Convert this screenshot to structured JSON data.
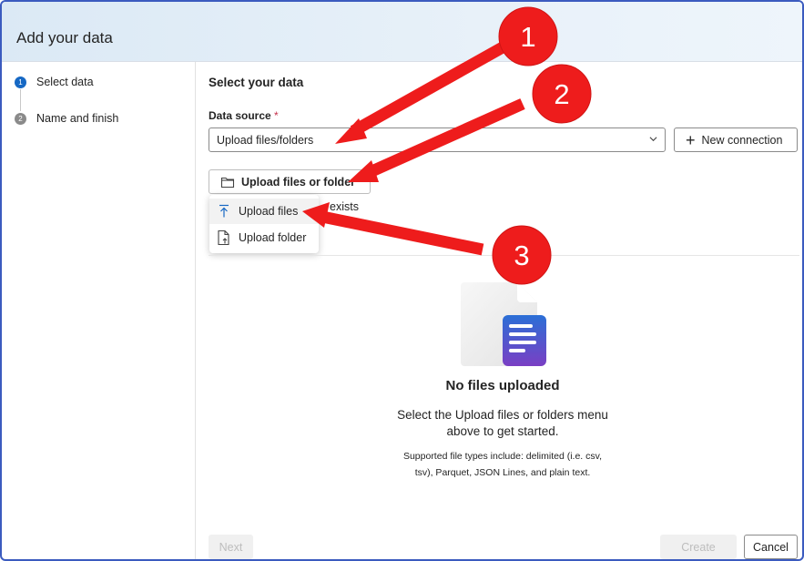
{
  "header": {
    "title": "Add your data"
  },
  "steps": [
    {
      "num": "1",
      "label": "Select data"
    },
    {
      "num": "2",
      "label": "Name and finish"
    }
  ],
  "main": {
    "section_title": "Select your data",
    "data_source_label": "Data source",
    "required_mark": "*",
    "data_source_value": "Upload files/folders",
    "new_connection_label": "New connection",
    "upload_button_label": "Upload files or folder",
    "exists_text": "exists"
  },
  "upload_menu": {
    "items": [
      {
        "label": "Upload files",
        "icon": "upload-arrow-icon"
      },
      {
        "label": "Upload folder",
        "icon": "folder-upload-icon"
      }
    ]
  },
  "empty_state": {
    "title": "No files uploaded",
    "message": "Select the Upload files or folders menu above to get started.",
    "supported": "Supported file types include: delimited (i.e. csv, tsv), Parquet, JSON Lines, and plain text."
  },
  "footer": {
    "next_label": "Next",
    "create_label": "Create",
    "cancel_label": "Cancel"
  },
  "annotations": {
    "color": "#ee1c1c",
    "badges": [
      "1",
      "2",
      "3"
    ]
  }
}
